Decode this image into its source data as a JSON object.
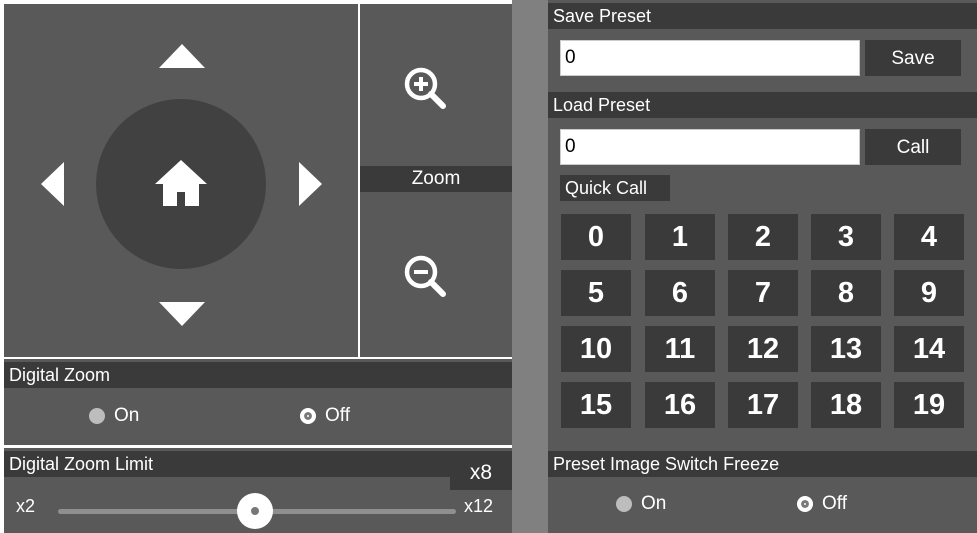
{
  "zoom": {
    "label": "Zoom"
  },
  "digital_zoom": {
    "title": "Digital Zoom",
    "options": [
      {
        "label": "On",
        "selected": false
      },
      {
        "label": "Off",
        "selected": true
      }
    ]
  },
  "digital_zoom_limit": {
    "title": "Digital Zoom Limit",
    "current": "x8",
    "min_label": "x2",
    "max_label": "x12"
  },
  "save_preset": {
    "title": "Save Preset",
    "value": "0",
    "button": "Save"
  },
  "load_preset": {
    "title": "Load Preset",
    "value": "0",
    "button": "Call"
  },
  "quick_call": {
    "title": "Quick Call",
    "numbers": [
      "0",
      "1",
      "2",
      "3",
      "4",
      "5",
      "6",
      "7",
      "8",
      "9",
      "10",
      "11",
      "12",
      "13",
      "14",
      "15",
      "16",
      "17",
      "18",
      "19"
    ]
  },
  "preset_freeze": {
    "title": "Preset Image Switch Freeze",
    "options": [
      {
        "label": "On",
        "selected": false
      },
      {
        "label": "Off",
        "selected": true
      }
    ]
  },
  "icons": [
    "arrow-up-icon",
    "arrow-down-icon",
    "arrow-left-icon",
    "arrow-right-icon",
    "home-icon",
    "zoom-in-icon",
    "zoom-out-icon"
  ]
}
